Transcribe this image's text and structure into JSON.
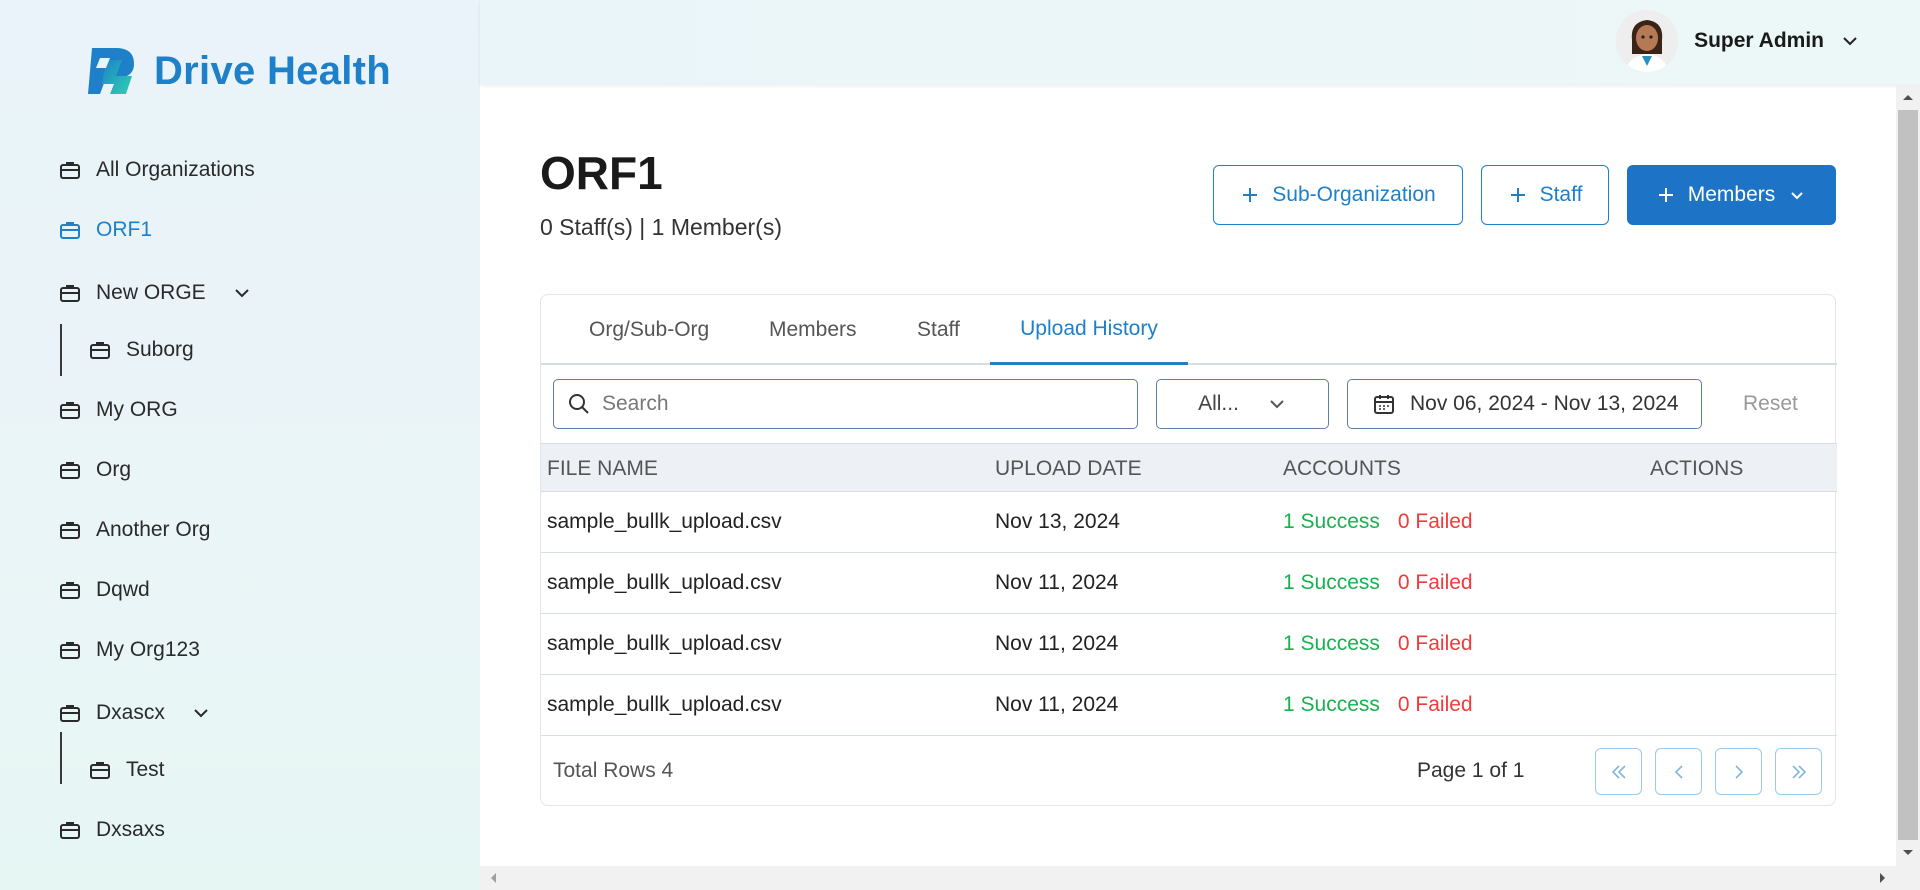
{
  "brand": {
    "name": "Drive Health",
    "primary": "#1d80c9"
  },
  "sidebar": {
    "items": [
      {
        "label": "All Organizations",
        "icon": "briefcase-icon"
      },
      {
        "label": "ORF1",
        "icon": "briefcase-icon",
        "active": true
      },
      {
        "label": "New ORGE",
        "icon": "briefcase-icon",
        "expandable": true
      },
      {
        "label": "Suborg",
        "icon": "briefcase-icon",
        "sub": true
      },
      {
        "label": "My ORG",
        "icon": "briefcase-icon"
      },
      {
        "label": "Org",
        "icon": "briefcase-icon"
      },
      {
        "label": "Another Org",
        "icon": "briefcase-icon"
      },
      {
        "label": "Dqwd",
        "icon": "briefcase-icon"
      },
      {
        "label": "My Org123",
        "icon": "briefcase-icon"
      },
      {
        "label": "Dxascx",
        "icon": "briefcase-icon",
        "expandable": true
      },
      {
        "label": "Test",
        "icon": "briefcase-icon",
        "sub": true
      },
      {
        "label": "Dxsaxs",
        "icon": "briefcase-icon"
      }
    ]
  },
  "header": {
    "user_name": "Super Admin"
  },
  "page": {
    "title": "ORF1",
    "subtitle": "0 Staff(s) | 1 Member(s)",
    "buttons": {
      "sub_org": "Sub-Organization",
      "staff": "Staff",
      "members": "Members"
    }
  },
  "tabs": [
    {
      "label": "Org/Sub-Org"
    },
    {
      "label": "Members"
    },
    {
      "label": "Staff"
    },
    {
      "label": "Upload History",
      "active": true
    }
  ],
  "filters": {
    "search_placeholder": "Search",
    "status_select": "All...",
    "date_range": "Nov 06, 2024 - Nov 13, 2024",
    "reset": "Reset"
  },
  "table": {
    "columns": [
      "FILE NAME",
      "UPLOAD DATE",
      "ACCOUNTS",
      "ACTIONS"
    ],
    "rows": [
      {
        "file": "sample_bullk_upload.csv",
        "date": "Nov 13, 2024",
        "success": "1 Success",
        "failed": "0 Failed"
      },
      {
        "file": "sample_bullk_upload.csv",
        "date": "Nov 11, 2024",
        "success": "1 Success",
        "failed": "0 Failed"
      },
      {
        "file": "sample_bullk_upload.csv",
        "date": "Nov 11, 2024",
        "success": "1 Success",
        "failed": "0 Failed"
      },
      {
        "file": "sample_bullk_upload.csv",
        "date": "Nov 11, 2024",
        "success": "1 Success",
        "failed": "0 Failed"
      }
    ]
  },
  "footer": {
    "total": "Total Rows 4",
    "page_info": "Page 1 of 1"
  }
}
